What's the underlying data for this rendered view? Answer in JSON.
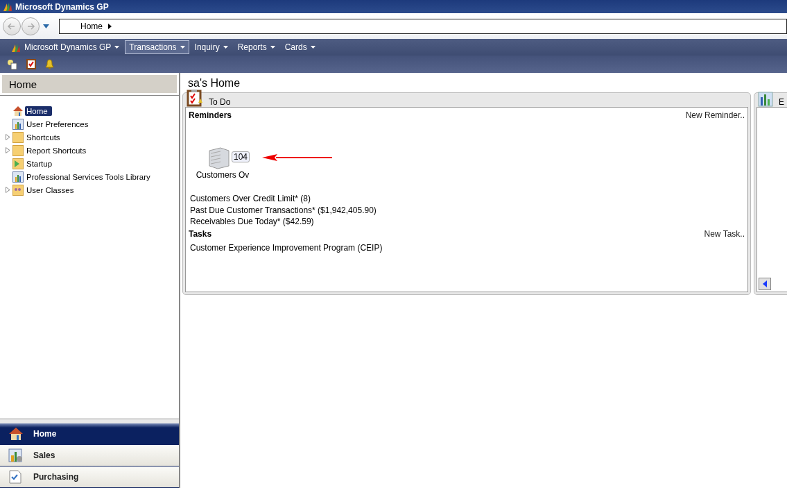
{
  "window": {
    "title": "Microsoft Dynamics GP"
  },
  "address_bar": {
    "path": "Home"
  },
  "menu": [
    {
      "label": "Microsoft Dynamics GP",
      "selected": false,
      "logo": true
    },
    {
      "label": "Transactions",
      "selected": true
    },
    {
      "label": "Inquiry",
      "selected": false
    },
    {
      "label": "Reports",
      "selected": false
    },
    {
      "label": "Cards",
      "selected": false
    }
  ],
  "navigation_pane": {
    "title": "Home",
    "tree": [
      {
        "label": "Home",
        "kind": "home",
        "selected": true
      },
      {
        "label": "User Preferences",
        "kind": "chart",
        "selected": false
      },
      {
        "label": "Shortcuts",
        "kind": "folder",
        "selected": false,
        "expanded": false
      },
      {
        "label": "Report Shortcuts",
        "kind": "folder",
        "selected": false,
        "expanded": false
      },
      {
        "label": "Startup",
        "kind": "startup",
        "selected": false
      },
      {
        "label": "Professional Services Tools Library",
        "kind": "chart",
        "selected": false
      },
      {
        "label": "User Classes",
        "kind": "users",
        "selected": false,
        "expanded": false
      }
    ],
    "buttons": [
      {
        "label": "Home",
        "kind": "home",
        "selected": true
      },
      {
        "label": "Sales",
        "kind": "sales",
        "selected": false
      },
      {
        "label": "Purchasing",
        "kind": "purchasing",
        "selected": false
      }
    ]
  },
  "content": {
    "title": "sa's Home",
    "todo": {
      "title": "To Do",
      "reminders_heading": "Reminders",
      "new_reminder": "New Reminder..",
      "tile": {
        "label": "Customers Ov",
        "count": "104"
      },
      "reminders": [
        "Customers Over Credit Limit* (8)",
        "Past Due Customer Transactions* ($1,942,405.90)",
        "Receivables Due Today* ($42.59)"
      ],
      "tasks_heading": "Tasks",
      "new_task": "New Task..",
      "tasks": [
        "Customer Experience Improvement Program (CEIP)"
      ]
    },
    "second_panel": {
      "title": "E"
    }
  }
}
